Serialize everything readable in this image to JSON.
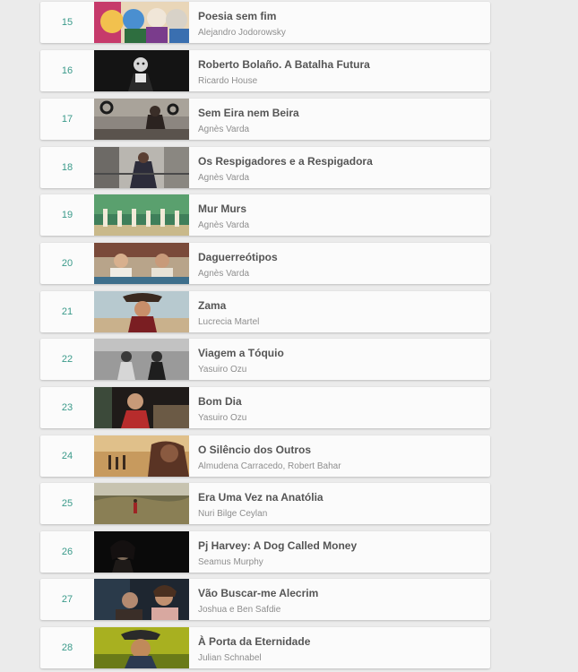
{
  "films": [
    {
      "rank": "15",
      "title": "Poesia sem fim",
      "director": "Alejandro Jodorowsky"
    },
    {
      "rank": "16",
      "title": "Roberto Bolaño. A Batalha Futura",
      "director": "Ricardo House"
    },
    {
      "rank": "17",
      "title": "Sem Eira nem Beira",
      "director": "Agnès Varda"
    },
    {
      "rank": "18",
      "title": "Os Respigadores e a Respigadora",
      "director": "Agnès Varda"
    },
    {
      "rank": "19",
      "title": "Mur Murs",
      "director": "Agnès Varda"
    },
    {
      "rank": "20",
      "title": "Daguerreótipos",
      "director": "Agnès Varda"
    },
    {
      "rank": "21",
      "title": "Zama",
      "director": "Lucrecia Martel"
    },
    {
      "rank": "22",
      "title": "Viagem a Tóquio",
      "director": "Yasuiro Ozu"
    },
    {
      "rank": "23",
      "title": "Bom Dia",
      "director": "Yasuiro Ozu"
    },
    {
      "rank": "24",
      "title": "O Silêncio dos Outros",
      "director": "Almudena Carracedo, Robert Bahar"
    },
    {
      "rank": "25",
      "title": "Era Uma Vez na Anatólia",
      "director": "Nuri Bilge Ceylan"
    },
    {
      "rank": "26",
      "title": "Pj Harvey: A Dog Called Money",
      "director": "Seamus Murphy"
    },
    {
      "rank": "27",
      "title": "Vão Buscar-me Alecrim",
      "director": "Joshua e Ben Safdie"
    },
    {
      "rank": "28",
      "title": "À Porta da Eternidade",
      "director": "Julian Schnabel"
    }
  ]
}
